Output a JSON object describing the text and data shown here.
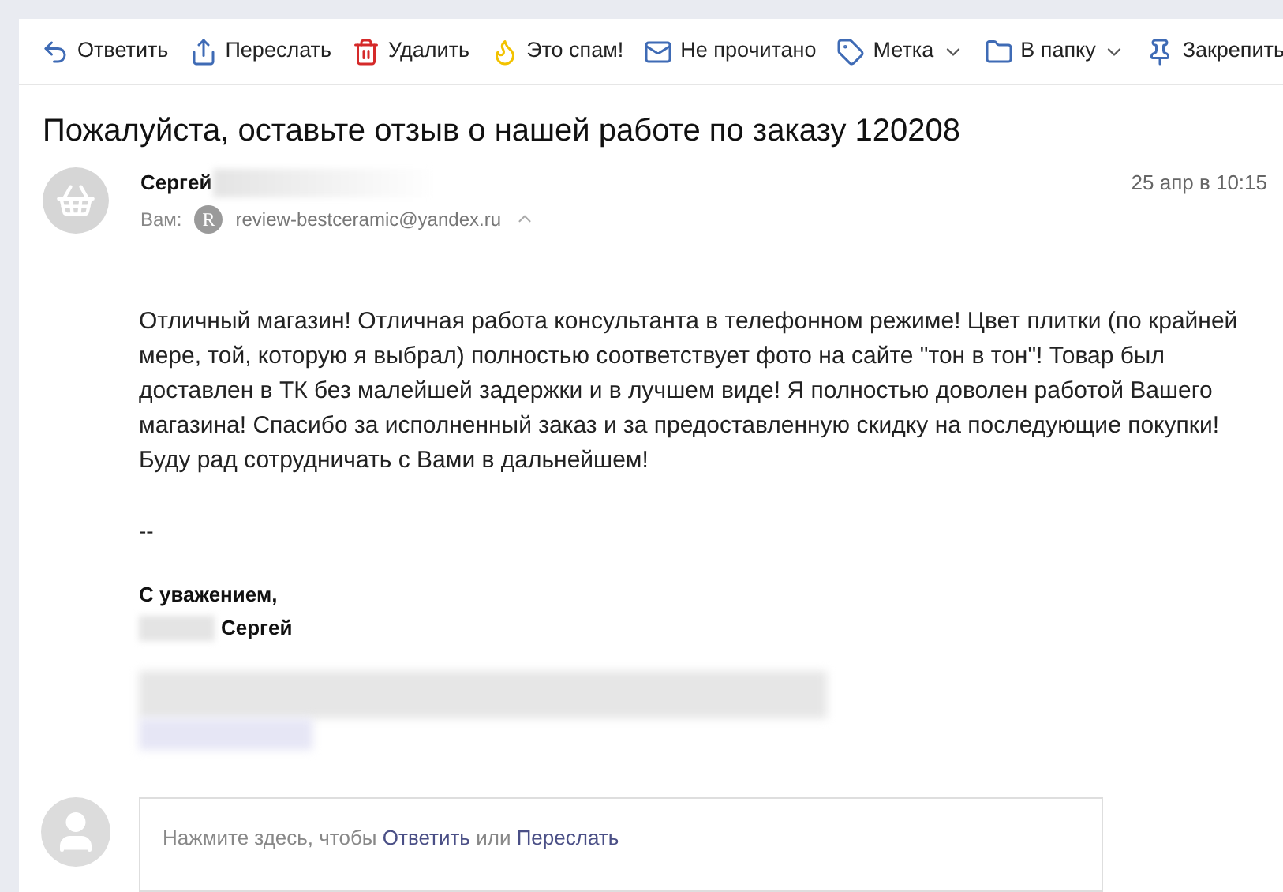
{
  "toolbar": [
    {
      "kind": "reply",
      "label": "Ответить",
      "dropdown": false
    },
    {
      "kind": "forward",
      "label": "Переслать",
      "dropdown": false
    },
    {
      "kind": "delete",
      "label": "Удалить",
      "dropdown": false
    },
    {
      "kind": "spam",
      "label": "Это спам!",
      "dropdown": false
    },
    {
      "kind": "unread",
      "label": "Не прочитано",
      "dropdown": false
    },
    {
      "kind": "label",
      "label": "Метка",
      "dropdown": true
    },
    {
      "kind": "folder",
      "label": "В папку",
      "dropdown": true
    },
    {
      "kind": "pin",
      "label": "Закрепить",
      "dropdown": false
    }
  ],
  "message": {
    "subject": "Пожалуйста, оставьте отзыв о нашей работе по заказу 120208",
    "sender": "Сергей",
    "date": "25 апр в 10:15",
    "to_label": "Вам:",
    "recipient_initial": "R",
    "recipient": "review-bestceramic@yandex.ru",
    "body": "Отличный магазин! Отличная работа консультанта в телефонном режиме! Цвет плитки (по крайней мере, той, которую я выбрал) полностью соответствует фото на сайте \"тон в тон\"! Товар был доставлен в ТК без малейшей задержки и в лучшем виде! Я полностью доволен работой Вашего магазина! Спасибо за исполненный заказ и за предоставленную скидку на последующие покупки! Буду рад сотрудничать с Вами в дальнейшем!",
    "separator": "--",
    "closing": "С уважением,",
    "signature_name": "Сергей"
  },
  "quick_reply": {
    "prefix": "Нажмите здесь, чтобы",
    "reply_link": "Ответить",
    "middle": "или",
    "forward_link": "Переслать"
  }
}
